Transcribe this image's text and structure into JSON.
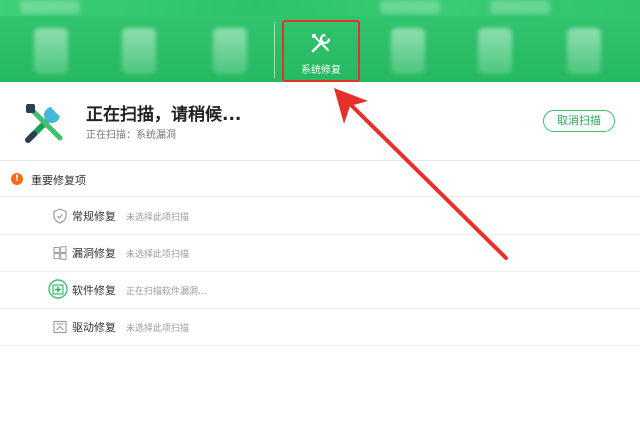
{
  "toolbar": {
    "active_tab_label": "系统修复"
  },
  "scan": {
    "title": "正在扫描，请稍候...",
    "subtitle": "正在扫描：系统漏洞",
    "cancel_label": "取消扫描"
  },
  "section": {
    "title": "重要修复项",
    "warn_glyph": "!"
  },
  "items": [
    {
      "label": "常规修复",
      "status": "未选择此项扫描",
      "icon": "shield-icon"
    },
    {
      "label": "漏洞修复",
      "status": "未选择此项扫描",
      "icon": "windows-icon"
    },
    {
      "label": "软件修复",
      "status": "正在扫描软件漏洞...",
      "icon": "software-box-icon"
    },
    {
      "label": "驱动修复",
      "status": "未选择此项扫描",
      "icon": "driver-icon"
    }
  ],
  "colors": {
    "accent_green": "#25b960",
    "highlight_red": "#e6312a",
    "warn_orange": "#ff6a1a"
  }
}
